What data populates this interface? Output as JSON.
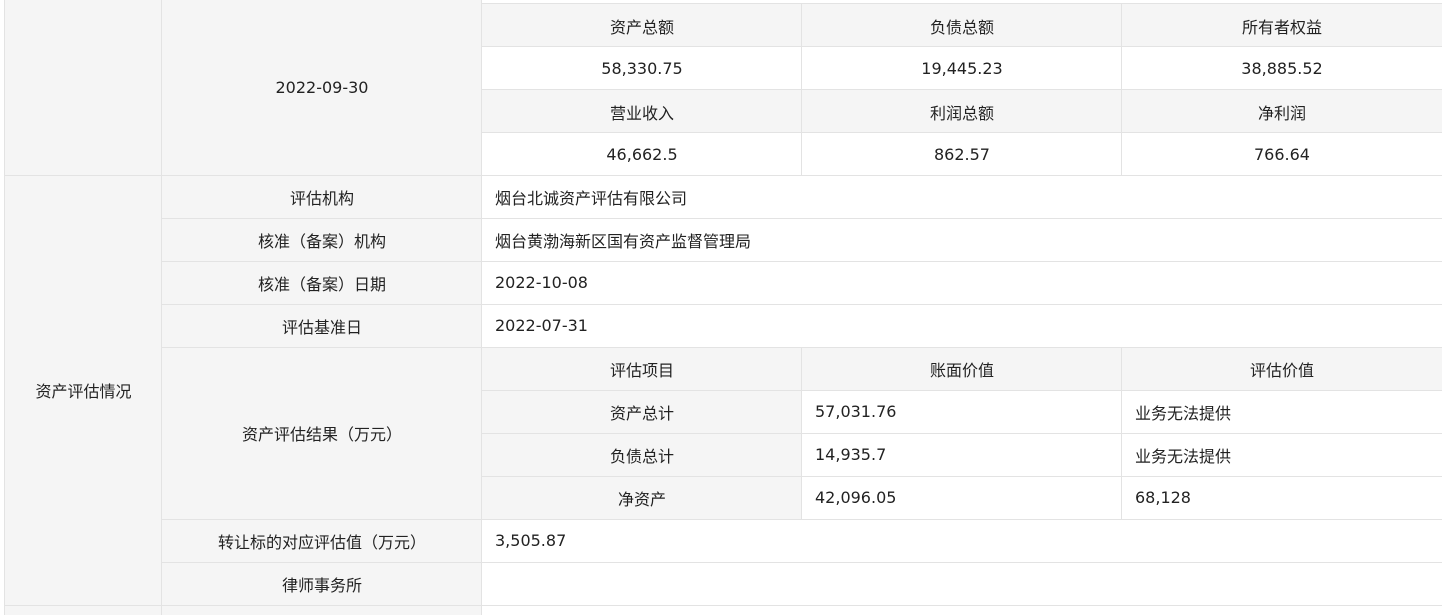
{
  "financials": {
    "date": "2022-09-30",
    "headers_1": [
      "资产总额",
      "负债总额",
      "所有者权益"
    ],
    "values_1": [
      "58,330.75",
      "19,445.23",
      "38,885.52"
    ],
    "headers_2": [
      "营业收入",
      "利润总额",
      "净利润"
    ],
    "values_2": [
      "46,662.5",
      "862.57",
      "766.64"
    ]
  },
  "valuation": {
    "section_label": "资产评估情况",
    "agency_label": "评估机构",
    "agency_value": "烟台北诚资产评估有限公司",
    "approval_org_label": "核准（备案）机构",
    "approval_org_value": "烟台黄渤海新区国有资产监督管理局",
    "approval_date_label": "核准（备案）日期",
    "approval_date_value": "2022-10-08",
    "base_date_label": "评估基准日",
    "base_date_value": "2022-07-31",
    "result_label": "资产评估结果（万元）",
    "result_headers": [
      "评估项目",
      "账面价值",
      "评估价值"
    ],
    "result_rows": [
      {
        "item": "资产总计",
        "book": "57,031.76",
        "appraised": "业务无法提供"
      },
      {
        "item": "负债总计",
        "book": "14,935.7",
        "appraised": "业务无法提供"
      },
      {
        "item": "净资产",
        "book": "42,096.05",
        "appraised": "68,128"
      }
    ],
    "target_value_label": "转让标的对应评估值（万元）",
    "target_value": "3,505.87",
    "law_firm_label": "律师事务所",
    "law_firm_value": ""
  }
}
